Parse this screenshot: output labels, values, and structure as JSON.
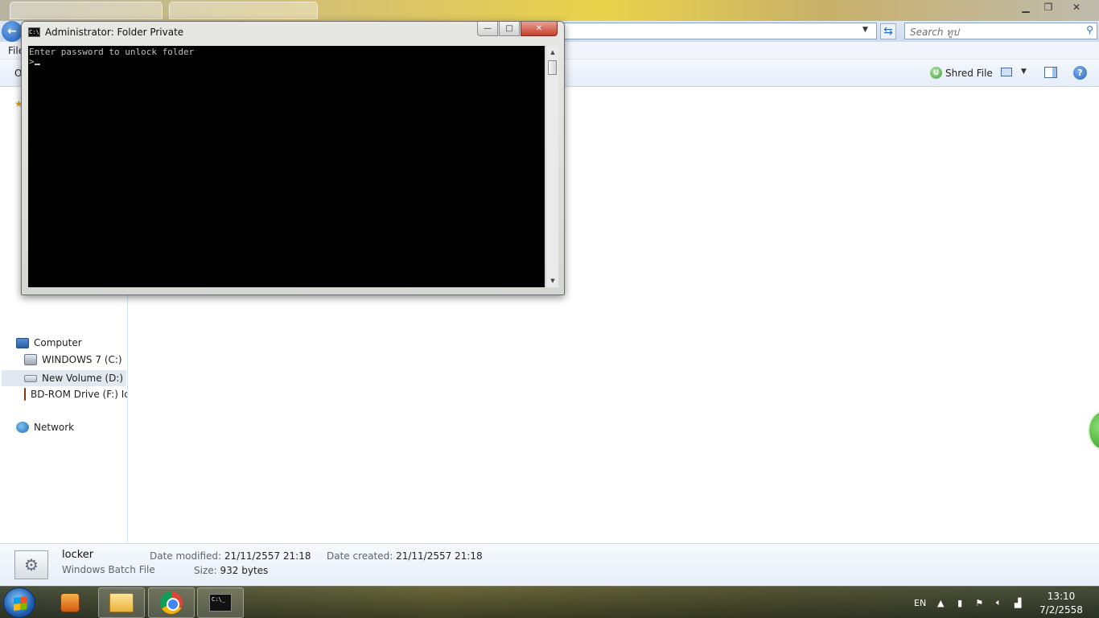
{
  "cmd_window": {
    "title": "Administrator:  Folder Private",
    "icon_text": "C:\\",
    "console_line1": "Enter password to unlock folder",
    "console_prompt": ">",
    "minimize_glyph": "—",
    "maximize_glyph": "□",
    "close_glyph": "✕"
  },
  "explorer": {
    "search_placeholder": "Search ทูป",
    "menu_file": "File",
    "cmd_org": "O",
    "shred_label": "Shred File",
    "shred_icon_letter": "U",
    "help_glyph": "?",
    "nav": {
      "computer": "Computer",
      "drive_c": "WINDOWS 7 (C:)",
      "drive_d": "New Volume (D:)",
      "drive_f": "BD-ROM Drive (F:) Ic",
      "network": "Network"
    },
    "details": {
      "name": "locker",
      "type": "Windows Batch File",
      "date_modified_label": "Date modified:",
      "date_modified_value": "21/11/2557 21:18",
      "date_created_label": "Date created:",
      "date_created_value": "21/11/2557 21:18",
      "size_label": "Size:",
      "size_value": "932 bytes"
    }
  },
  "taskbar": {
    "cmd_icon_text": "C:\\_",
    "language": "EN",
    "time": "13:10",
    "date": "7/2/2558"
  },
  "colors": {
    "console_bg": "#000000",
    "console_text": "#c0c0c0",
    "close_button": "#c6402a"
  }
}
